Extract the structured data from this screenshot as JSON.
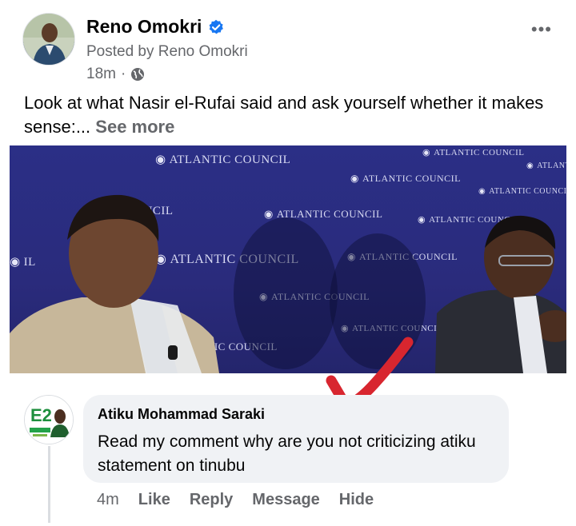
{
  "post": {
    "author": "Reno Omokri",
    "posted_by": "Posted by Reno Omokri",
    "time": "18m",
    "separator": "·",
    "audience_icon": "globe-icon",
    "more_label": "•••",
    "text": "Look at what Nasir el-Rufai said and ask yourself whether it makes sense:... ",
    "see_more": "See more",
    "verified_color": "#1877f2"
  },
  "photo": {
    "backdrop_texts": [
      "ATLANTIC COUNCIL",
      "ATLANTIC COUNCIL",
      "ATLANTIC COUNCIL",
      "ATLANTIC COUNCIL",
      "ATLANTIC COUNCIL",
      "ATLANTIC COUNCIL",
      "ATLANTIC COUNCIL",
      "ATLANTIC COUNCIL",
      "ATLANTIC COUNCIL",
      "ATLANTIC COUNCIL",
      "ATLANTIC COUNCIL",
      "NCIL",
      "IL",
      "IC COUNCIL"
    ]
  },
  "comment": {
    "author": "Atiku Mohammad Saraki",
    "text": "Read my comment why are you not criticizing atiku statement on tinubu",
    "time": "4m",
    "actions": {
      "like": "Like",
      "reply": "Reply",
      "message": "Message",
      "hide": "Hide"
    },
    "avatar_text": "E2"
  },
  "annotation": {
    "arrow_color": "#d8262f"
  }
}
